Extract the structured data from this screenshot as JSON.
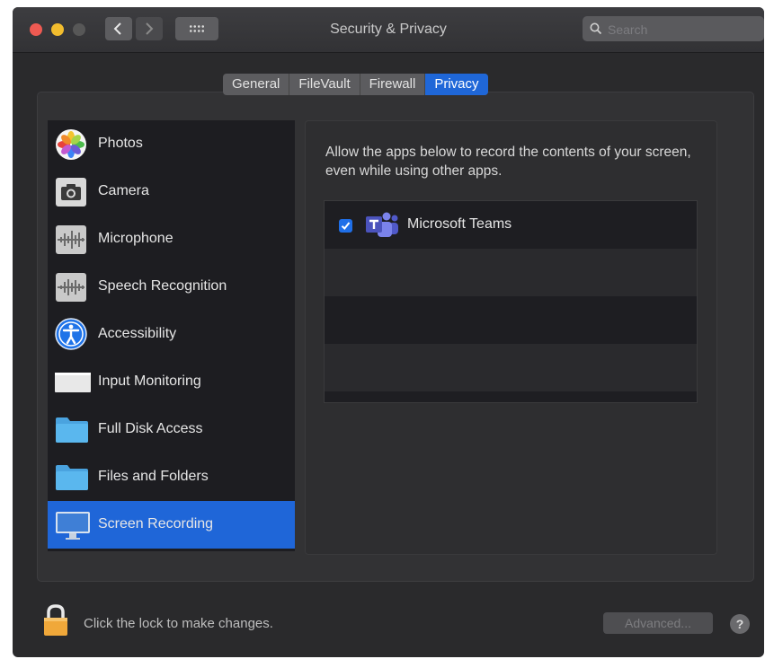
{
  "window": {
    "title": "Security & Privacy",
    "search_placeholder": "Search"
  },
  "tabs": [
    {
      "label": "General",
      "selected": false
    },
    {
      "label": "FileVault",
      "selected": false
    },
    {
      "label": "Firewall",
      "selected": false
    },
    {
      "label": "Privacy",
      "selected": true
    }
  ],
  "sidebar": {
    "items": [
      {
        "label": "Photos",
        "icon": "photos-icon"
      },
      {
        "label": "Camera",
        "icon": "camera-icon"
      },
      {
        "label": "Microphone",
        "icon": "microphone-icon"
      },
      {
        "label": "Speech Recognition",
        "icon": "speech-recognition-icon"
      },
      {
        "label": "Accessibility",
        "icon": "accessibility-icon"
      },
      {
        "label": "Input Monitoring",
        "icon": "keyboard-icon"
      },
      {
        "label": "Full Disk Access",
        "icon": "folder-icon"
      },
      {
        "label": "Files and Folders",
        "icon": "folder-icon"
      },
      {
        "label": "Screen Recording",
        "icon": "display-icon",
        "selected": true
      }
    ]
  },
  "content": {
    "description": "Allow the apps below to record the contents of your screen, even while using other apps.",
    "apps": [
      {
        "name": "Microsoft Teams",
        "checked": true,
        "icon": "microsoft-teams-icon"
      }
    ]
  },
  "footer": {
    "lock_text": "Click the lock to make changes.",
    "advanced_label": "Advanced...",
    "help_label": "?"
  },
  "colors": {
    "accent": "#1f66d8",
    "close": "#ee5a52",
    "minimize": "#f2bd2e"
  }
}
